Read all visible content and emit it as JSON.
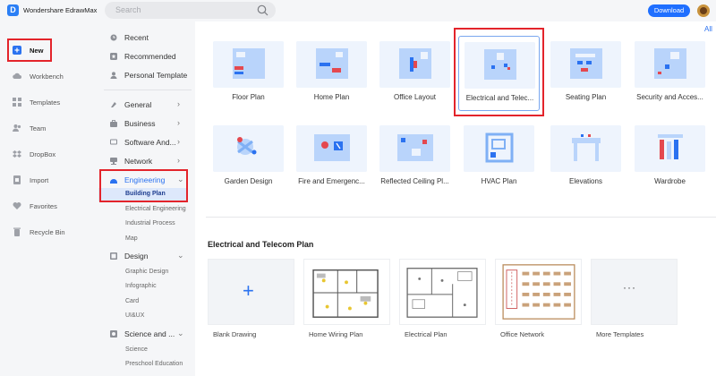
{
  "app": {
    "title": "Wondershare EdrawMax",
    "logo_letter": "D"
  },
  "search": {
    "placeholder": "Search"
  },
  "header": {
    "download_label": "Download"
  },
  "leftnav": {
    "items": [
      {
        "label": "New",
        "icon": "plus-square-icon",
        "active": true
      },
      {
        "label": "Workbench",
        "icon": "cloud-icon"
      },
      {
        "label": "Templates",
        "icon": "grid-icon"
      },
      {
        "label": "Team",
        "icon": "team-icon"
      },
      {
        "label": "DropBox",
        "icon": "dropbox-icon"
      },
      {
        "label": "Import",
        "icon": "import-icon"
      },
      {
        "label": "Favorites",
        "icon": "heart-icon"
      },
      {
        "label": "Recycle Bin",
        "icon": "trash-icon"
      }
    ]
  },
  "categories": {
    "top": [
      {
        "label": "Recent",
        "icon": "clock-icon"
      },
      {
        "label": "Recommended",
        "icon": "star-icon"
      },
      {
        "label": "Personal Template",
        "icon": "person-icon"
      }
    ],
    "groups": [
      {
        "label": "General",
        "icon": "general-icon",
        "chevron": "›"
      },
      {
        "label": "Business",
        "icon": "business-icon",
        "chevron": "›"
      },
      {
        "label": "Software And...",
        "icon": "software-icon",
        "chevron": "›"
      },
      {
        "label": "Network",
        "icon": "network-icon",
        "chevron": "›"
      },
      {
        "label": "Engineering",
        "icon": "engineering-icon",
        "chevron": "⌄",
        "active": true
      }
    ],
    "engineering_sub": [
      {
        "label": "Building Plan",
        "active": true
      },
      {
        "label": "Electrical Engineering"
      },
      {
        "label": "Industrial Process"
      },
      {
        "label": "Map"
      }
    ],
    "design": {
      "label": "Design",
      "icon": "design-icon",
      "chevron": "⌄"
    },
    "design_sub": [
      {
        "label": "Graphic Design"
      },
      {
        "label": "Infographic"
      },
      {
        "label": "Card"
      },
      {
        "label": "UI&UX"
      }
    ],
    "science": {
      "label": "Science and ...",
      "icon": "science-icon",
      "chevron": "⌄"
    },
    "science_sub": [
      {
        "label": "Science"
      },
      {
        "label": "Preschool Education"
      }
    ]
  },
  "main": {
    "all_label": "All",
    "row1": [
      {
        "label": "Floor Plan"
      },
      {
        "label": "Home Plan"
      },
      {
        "label": "Office Layout"
      },
      {
        "label": "Electrical and Telec...",
        "selected": true
      },
      {
        "label": "Seating Plan"
      },
      {
        "label": "Security and Acces..."
      }
    ],
    "row2": [
      {
        "label": "Garden Design"
      },
      {
        "label": "Fire and Emergenc..."
      },
      {
        "label": "Reflected Ceiling Pl..."
      },
      {
        "label": "HVAC Plan"
      },
      {
        "label": "Elevations"
      },
      {
        "label": "Wardrobe"
      }
    ],
    "section_title": "Electrical and Telecom Plan",
    "templates": [
      {
        "label": "Blank Drawing",
        "glyph": "+"
      },
      {
        "label": "Home Wiring Plan"
      },
      {
        "label": "Electrical Plan"
      },
      {
        "label": "Office Network"
      },
      {
        "label": "More Templates",
        "glyph": "···"
      }
    ]
  },
  "colors": {
    "accent": "#2b72f0",
    "highlight_red": "#e3242b",
    "download": "#1f6fff"
  }
}
